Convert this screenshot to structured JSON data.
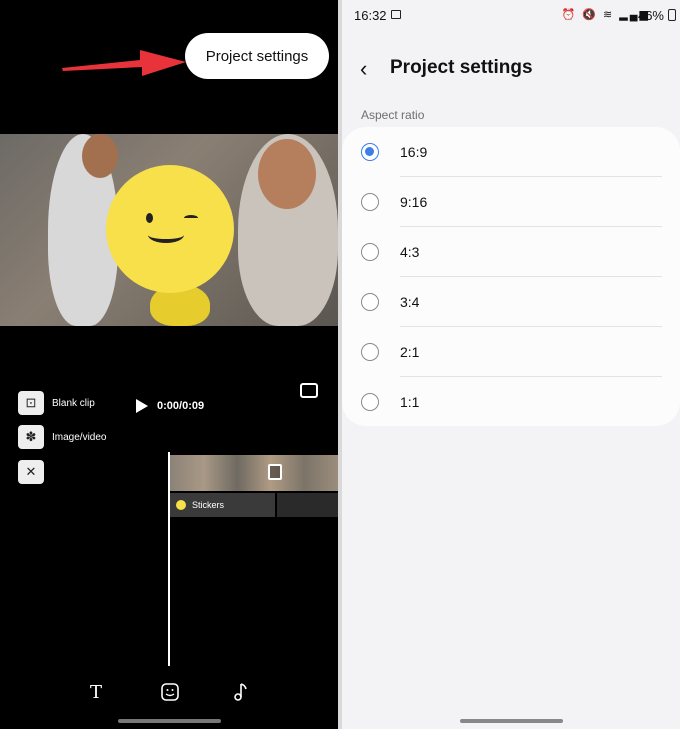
{
  "left": {
    "callout_label": "Project settings",
    "tools": {
      "blank_clip_label": "Blank clip",
      "image_video_label": "Image/video",
      "close_symbol": "✕"
    },
    "playback_time": "0:00/0:09",
    "sticker_track_label": "Stickers",
    "bottom_icons": [
      "text-icon",
      "sticker-icon",
      "music-icon"
    ]
  },
  "right": {
    "status_bar": {
      "time": "16:32",
      "battery": "46%"
    },
    "title": "Project settings",
    "section_label": "Aspect ratio",
    "options": [
      {
        "label": "16:9",
        "selected": true
      },
      {
        "label": "9:16",
        "selected": false
      },
      {
        "label": "4:3",
        "selected": false
      },
      {
        "label": "3:4",
        "selected": false
      },
      {
        "label": "2:1",
        "selected": false
      },
      {
        "label": "1:1",
        "selected": false
      }
    ]
  },
  "colors": {
    "accent": "#3d7ee8",
    "arrow": "#e8333b",
    "sticker": "#f7e04a"
  }
}
